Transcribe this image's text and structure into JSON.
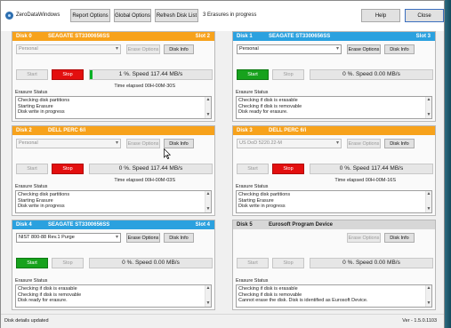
{
  "app": {
    "title": "ZeroDataWindows",
    "toolbar": {
      "report_options": "Report Options",
      "global_options": "Global Options",
      "refresh_disk_list": "Refresh Disk List",
      "help": "Help",
      "close": "Close"
    },
    "status_top": "3 Erasures in progress"
  },
  "panels": [
    {
      "disk": "Disk 0",
      "name": "SEAGATE ST3300656SS",
      "slot": "Slot 2",
      "header_color": "orange",
      "method": "Personal",
      "method_active": false,
      "erase_options": "Erase Options",
      "erase_enabled": false,
      "disk_info": "Disk Info",
      "start": "Start",
      "stop": "Stop",
      "start_enabled": false,
      "stop_enabled": true,
      "progress": "1 %. Speed 117.44 MB/s",
      "progress_fraction": 0.01,
      "elapsed": "Time elapsed 00H-00M-30S",
      "erasure_status_label": "Erasure Status",
      "log": [
        "Checking disk partitions",
        "Starting Erasure",
        "Disk write in progress"
      ]
    },
    {
      "disk": "Disk 1",
      "name": "SEAGATE ST3300656SS",
      "slot": "Slot 3",
      "header_color": "blue",
      "method": "Personal",
      "method_active": true,
      "erase_options": "Erase Options",
      "erase_enabled": true,
      "disk_info": "Disk Info",
      "start": "Start",
      "stop": "Stop",
      "start_enabled": true,
      "stop_enabled": false,
      "progress": "0 %. Speed 0.00 MB/s",
      "progress_fraction": 0,
      "elapsed": "",
      "erasure_status_label": "Erasure Status",
      "log": [
        "Checking if disk is erasable",
        "Checking if disk is removable",
        "Disk ready for erasure."
      ]
    },
    {
      "disk": "Disk 2",
      "name": "DELL PERC 6/i",
      "slot": "",
      "header_color": "orange",
      "method": "Personal",
      "method_active": false,
      "erase_options": "Erase Options",
      "erase_enabled": false,
      "disk_info": "Disk Info",
      "start": "Start",
      "stop": "Stop",
      "start_enabled": false,
      "stop_enabled": true,
      "progress": "0 %. Speed 117.44 MB/s",
      "progress_fraction": 0,
      "elapsed": "Time elapsed 00H-00M-03S",
      "erasure_status_label": "Erasure Status",
      "log": [
        "Checking disk partitions",
        "Starting Erasure",
        "Disk write in progress"
      ]
    },
    {
      "disk": "Disk 3",
      "name": "DELL PERC 6/i",
      "slot": "",
      "header_color": "orange",
      "method": "US DoD 5220.22-M",
      "method_active": false,
      "erase_options": "Erase Options",
      "erase_enabled": false,
      "disk_info": "Disk Info",
      "start": "Start",
      "stop": "Stop",
      "start_enabled": false,
      "stop_enabled": true,
      "progress": "0 %. Speed 117.44 MB/s",
      "progress_fraction": 0,
      "elapsed": "Time elapsed 00H-00M-16S",
      "erasure_status_label": "Erasure Status",
      "log": [
        "Checking disk partitions",
        "Starting Erasure",
        "Disk write in progress"
      ]
    },
    {
      "disk": "Disk 4",
      "name": "SEAGATE ST3300656SS",
      "slot": "Slot 4",
      "header_color": "blue",
      "method": "NIST 800-88 Rev.1 Purge",
      "method_active": true,
      "erase_options": "Erase Options",
      "erase_enabled": true,
      "disk_info": "Disk Info",
      "start": "Start",
      "stop": "Stop",
      "start_enabled": true,
      "stop_enabled": false,
      "progress": "0 %. Speed 0.00 MB/s",
      "progress_fraction": 0,
      "elapsed": "",
      "erasure_status_label": "Erasure Status",
      "log": [
        "Checking if disk is erasable",
        "Checking if disk is removable",
        "Disk ready for erasure."
      ]
    },
    {
      "disk": "Disk 5",
      "name": "Eurosoft Program Device",
      "slot": "",
      "header_color": "grey",
      "method": "",
      "method_active": false,
      "hide_method": true,
      "erase_options": "Erase Options",
      "erase_enabled": false,
      "disk_info": "Disk Info",
      "start": "Start",
      "stop": "Stop",
      "start_enabled": false,
      "stop_enabled": false,
      "progress": "0 %. Speed 0.00 MB/s",
      "progress_fraction": 0,
      "elapsed": "",
      "erasure_status_label": "Erasure Status",
      "log": [
        "Checking if disk is erasable",
        "Checking if disk is removable",
        "Cannot erase the disk. Disk is identified as Eurosoft Device."
      ]
    }
  ],
  "statusbar": {
    "left": "Disk details updated",
    "right": "Ver - 1.5.0.1103"
  },
  "colors": {
    "orange": "#f7a21b",
    "blue": "#2ba1df",
    "grey": "#d7d7d7",
    "start_green": "#17a21d",
    "stop_red": "#e30f0f",
    "progress_green": "#06b025"
  },
  "icons": {
    "app": "app-icon",
    "cursor": "mouse-pointer-icon",
    "scroll_up": "scroll-up-arrow-icon",
    "scroll_down": "scroll-down-arrow-icon",
    "dropdown": "chevron-down-icon"
  }
}
